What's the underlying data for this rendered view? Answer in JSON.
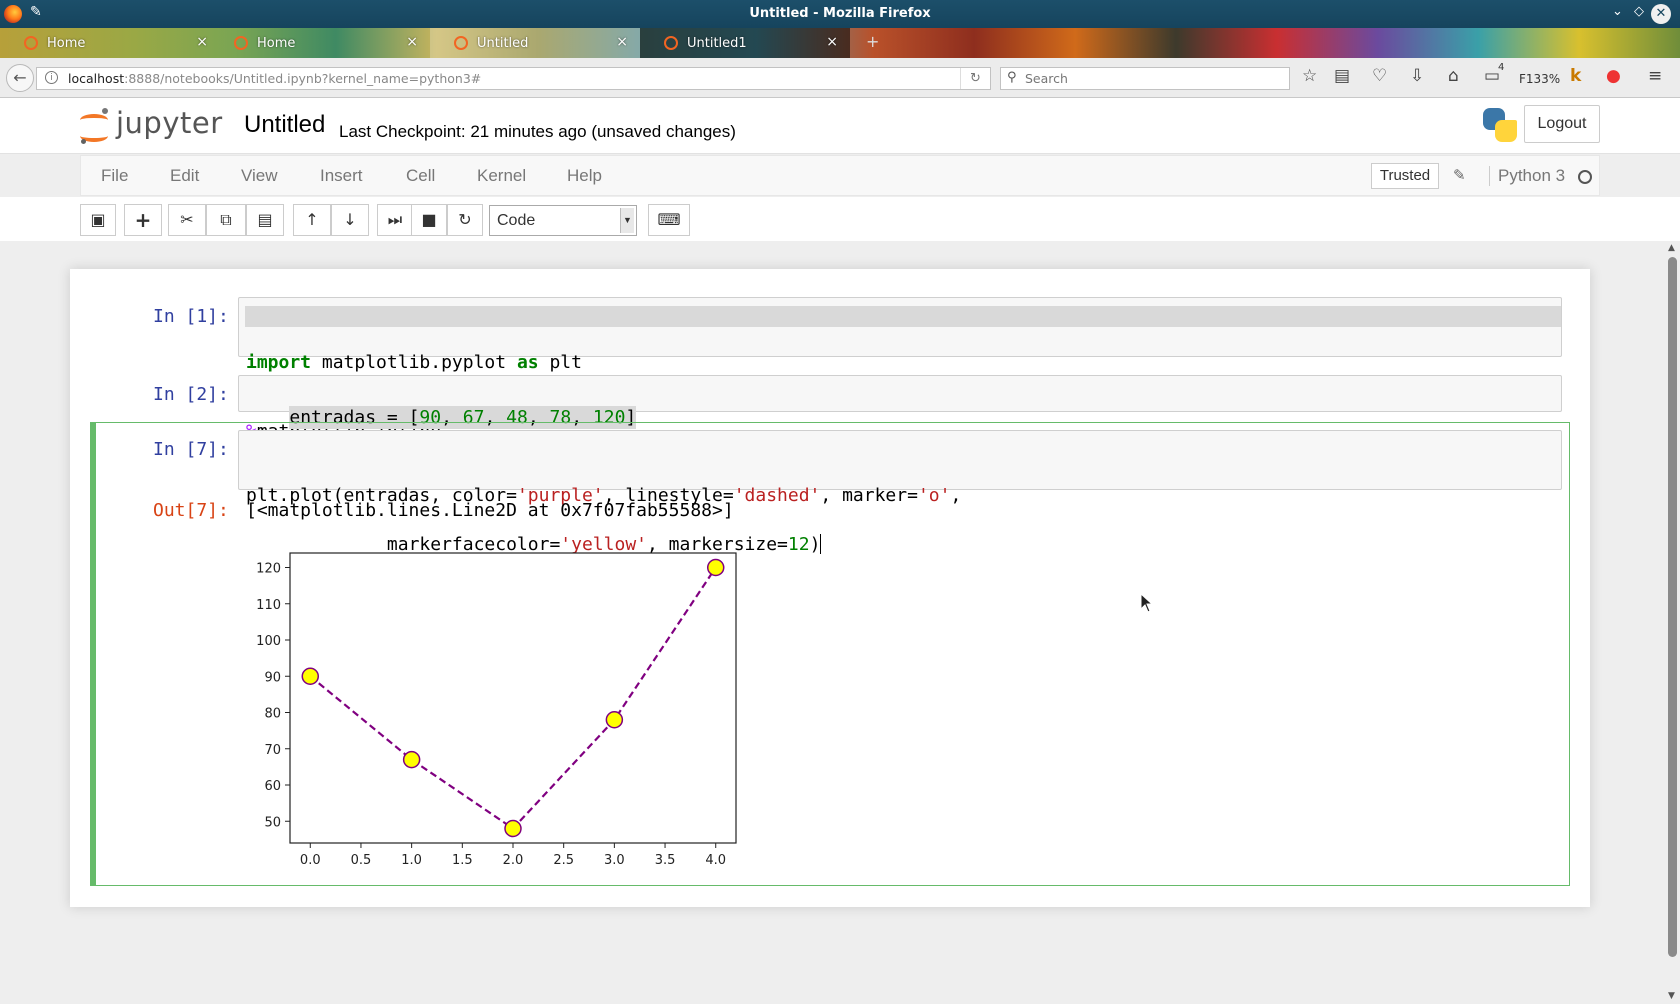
{
  "window": {
    "title": "Untitled - Mozilla Firefox"
  },
  "tabs": [
    {
      "label": "Home",
      "close": "×"
    },
    {
      "label": "Home",
      "close": "×"
    },
    {
      "label": "Untitled",
      "close": "×"
    },
    {
      "label": "Untitled1",
      "close": "×"
    }
  ],
  "navbar": {
    "url_host": "localhost",
    "url_rest": ":8888/notebooks/Untitled.ipynb?kernel_name=python3#",
    "search_placeholder": "Search",
    "zoom": "F133%",
    "notif_count": "4"
  },
  "jupyter": {
    "logo_text": "jupyter",
    "notebook_name": "Untitled",
    "checkpoint": "Last Checkpoint: 21 minutes ago (unsaved changes)",
    "logout": "Logout",
    "menu": [
      "File",
      "Edit",
      "View",
      "Insert",
      "Cell",
      "Kernel",
      "Help"
    ],
    "trusted": "Trusted",
    "kernel": "Python 3",
    "cell_type": "Code"
  },
  "cells": [
    {
      "prompt": "In [1]:",
      "lines": [
        [
          {
            "t": "import",
            "c": "kw"
          },
          {
            "t": " matplotlib.pyplot ",
            "c": ""
          },
          {
            "t": "as",
            "c": "kw"
          },
          {
            "t": " plt",
            "c": ""
          }
        ],
        [
          {
            "t": "%",
            "c": "pct"
          },
          {
            "t": "matplotlib inline",
            "c": ""
          }
        ]
      ]
    },
    {
      "prompt": "In [2]:",
      "lines": [
        [
          {
            "t": "entradas = [",
            "c": ""
          },
          {
            "t": "90",
            "c": "num"
          },
          {
            "t": ", ",
            "c": ""
          },
          {
            "t": "67",
            "c": "num"
          },
          {
            "t": ", ",
            "c": ""
          },
          {
            "t": "48",
            "c": "num"
          },
          {
            "t": ", ",
            "c": ""
          },
          {
            "t": "78",
            "c": "num"
          },
          {
            "t": ", ",
            "c": ""
          },
          {
            "t": "120",
            "c": "num"
          },
          {
            "t": "]",
            "c": ""
          }
        ]
      ]
    },
    {
      "prompt": "In [7]:",
      "lines": [
        [
          {
            "t": "plt.plot(entradas, color=",
            "c": ""
          },
          {
            "t": "'purple'",
            "c": "str"
          },
          {
            "t": ", linestyle=",
            "c": ""
          },
          {
            "t": "'dashed'",
            "c": "str"
          },
          {
            "t": ", marker=",
            "c": ""
          },
          {
            "t": "'o'",
            "c": "str"
          },
          {
            "t": ",",
            "c": ""
          }
        ],
        [
          {
            "t": "         markerfacecolor=",
            "c": ""
          },
          {
            "t": "'yellow'",
            "c": "str"
          },
          {
            "t": ", markersize=",
            "c": ""
          },
          {
            "t": "12",
            "c": "num"
          },
          {
            "t": ")",
            "c": ""
          }
        ]
      ],
      "out_prompt": "Out[7]:",
      "out_text": "[<matplotlib.lines.Line2D at 0x7f07fab55588>]"
    }
  ],
  "chart_data": {
    "type": "line",
    "x": [
      0.0,
      1.0,
      2.0,
      3.0,
      4.0
    ],
    "series": [
      {
        "values": [
          90,
          67,
          48,
          78,
          120
        ]
      }
    ],
    "line_color": "#800080",
    "linestyle": "dashed",
    "marker": "o",
    "marker_face_color": "#ffff00",
    "xlim": [
      -0.2,
      4.2
    ],
    "ylim": [
      44,
      124
    ],
    "xticks": [
      "0.0",
      "0.5",
      "1.0",
      "1.5",
      "2.0",
      "2.5",
      "3.0",
      "3.5",
      "4.0"
    ],
    "yticks": [
      "50",
      "60",
      "70",
      "80",
      "90",
      "100",
      "110",
      "120"
    ],
    "grid": false,
    "title": "",
    "xlabel": "",
    "ylabel": ""
  },
  "colors": {
    "accent_selected_cell": "#66bb6a",
    "prompt_in": "#303f9f",
    "prompt_out": "#d84315",
    "jupyter_orange": "#f37726"
  }
}
